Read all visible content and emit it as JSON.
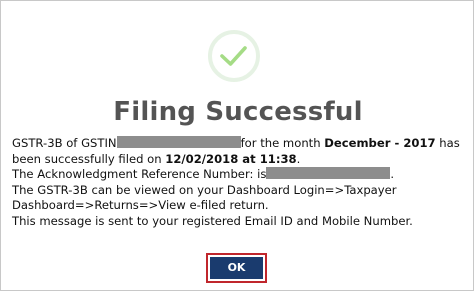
{
  "dialog": {
    "icon": "checkmark-circle-icon",
    "title": "Filing Successful",
    "message": {
      "l1_a": "GSTR-3B of GSTIN",
      "l1_b": "for the month ",
      "l1_month": "December - 2017",
      "l1_c": " has",
      "l2_a": "been successfully filed on ",
      "l2_date": "12/02/2018 at 11:38",
      "l2_b": ".",
      "l3_a": "The Acknowledgment Reference Number: is",
      "l3_b": ".",
      "l4": "The GSTR-3B can be viewed on your Dashboard Login=>Taxpayer",
      "l5": "Dashboard=>Returns=>View e-filed return.",
      "l6": "This message is sent to your registered Email ID and Mobile Number."
    },
    "ok_label": "OK"
  },
  "colors": {
    "title": "#545454",
    "check": "#a5dc86",
    "check_ring": "#e6f2e4",
    "ok_button_bg": "#1a3b6e",
    "ok_outline": "#c0262c",
    "redaction": "#8d8d8d"
  }
}
